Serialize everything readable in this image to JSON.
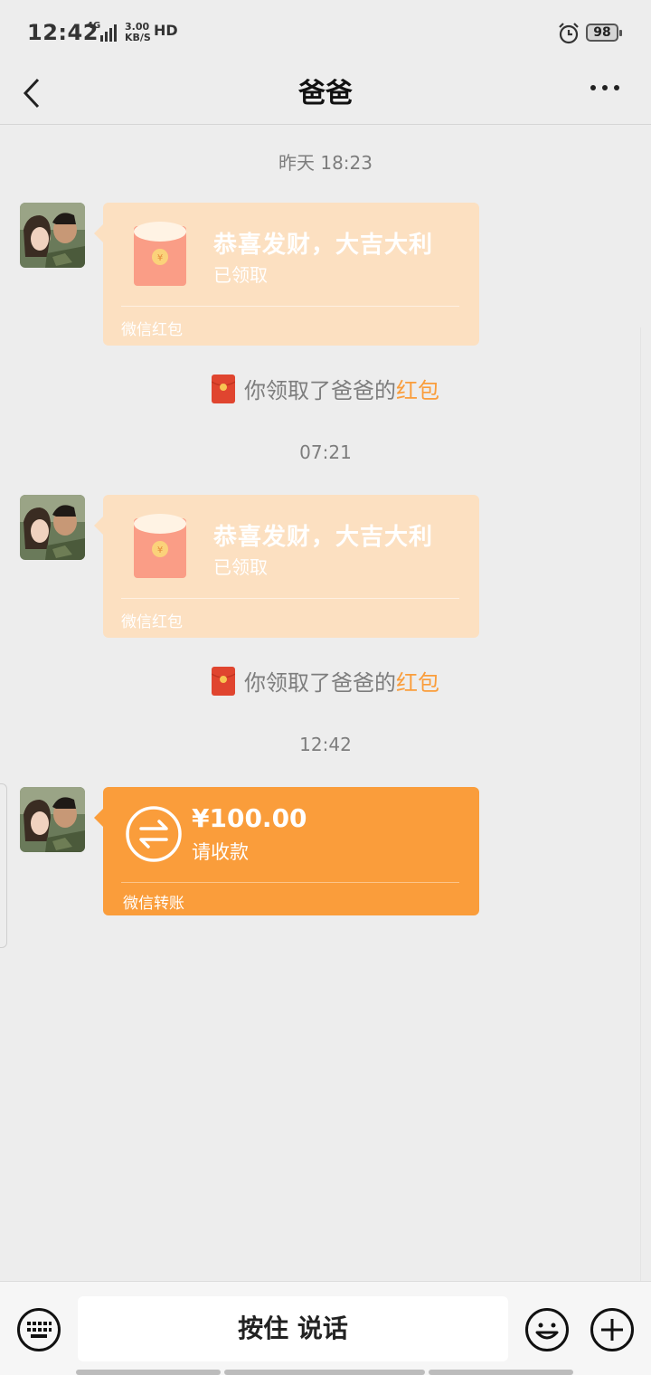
{
  "status_bar": {
    "time": "12:42",
    "network": "4G",
    "speed_value": "3.00",
    "speed_unit": "KB/S",
    "hd": "HD",
    "battery": "98"
  },
  "nav": {
    "title": "爸爸"
  },
  "messages": {
    "t1": "昨天 18:23",
    "rp1": {
      "title": "恭喜发财，大吉大利",
      "status": "已领取",
      "footer": "微信红包"
    },
    "notice1": {
      "prefix": "你领取了爸爸的",
      "highlight": "红包"
    },
    "t2": "07:21",
    "rp2": {
      "title": "恭喜发财，大吉大利",
      "status": "已领取",
      "footer": "微信红包"
    },
    "notice2": {
      "prefix": "你领取了爸爸的",
      "highlight": "红包"
    },
    "t3": "12:42",
    "transfer": {
      "amount": "¥100.00",
      "note": "请收款",
      "footer": "微信转账"
    }
  },
  "input_bar": {
    "voice_label": "按住 说话"
  },
  "icons": [
    "keyboard-icon",
    "emoji-icon",
    "plus-icon",
    "back-icon",
    "more-icon",
    "red-packet-icon",
    "transfer-icon",
    "alarm-icon",
    "signal-icon"
  ],
  "colors": {
    "red_packet_bg": "#fce0c1",
    "transfer_bg": "#fa9d3b",
    "accent": "#fa9d3b",
    "background": "#ededed"
  }
}
